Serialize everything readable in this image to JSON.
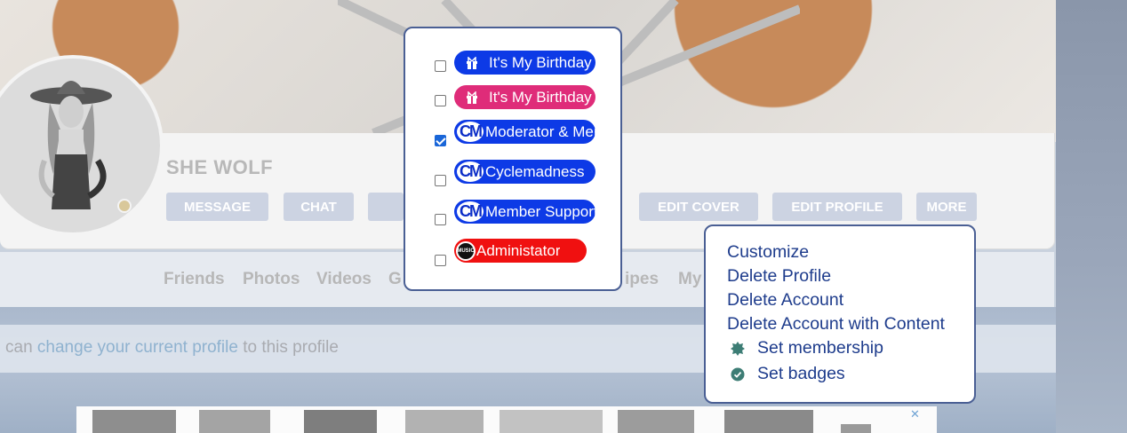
{
  "profile": {
    "name": "SHE WOLF",
    "actions": [
      {
        "label": "MESSAGE"
      },
      {
        "label": "CHAT"
      },
      {
        "label": ""
      },
      {
        "label": "EDIT COVER"
      },
      {
        "label": "EDIT PROFILE"
      },
      {
        "label": "MORE"
      }
    ]
  },
  "nav": {
    "items": [
      "Friends",
      "Photos",
      "Videos",
      "G",
      "ipes",
      "My"
    ]
  },
  "notice": {
    "prefix": "can ",
    "link": "change your current profile",
    "suffix": " to this profile"
  },
  "badges": [
    {
      "label": "It's My Birthday",
      "checked": false,
      "color": "#0d3ae6",
      "icon": "gift-icon"
    },
    {
      "label": "It's My Birthday",
      "checked": false,
      "color": "#df2c79",
      "icon": "gift-icon"
    },
    {
      "label": "Moderator & Member",
      "checked": true,
      "color": "#0d3ae6",
      "icon": "cm-logo-icon",
      "icon_text": "CM"
    },
    {
      "label": "Cyclemadness",
      "checked": false,
      "color": "#0d3ae6",
      "icon": "cm-logo-icon",
      "icon_text": "CM"
    },
    {
      "label": "Member Support",
      "checked": false,
      "color": "#0d3ae6",
      "icon": "cm-logo-icon",
      "icon_text": "CM"
    },
    {
      "label": "Administator",
      "checked": false,
      "color": "#f01010",
      "icon": "music-icon",
      "icon_text": "MUSIC"
    }
  ],
  "more_menu": {
    "items": [
      {
        "label": "Customize",
        "icon": null
      },
      {
        "label": "Delete Profile",
        "icon": null
      },
      {
        "label": "Delete Account",
        "icon": null
      },
      {
        "label": "Delete Account with Content",
        "icon": null
      },
      {
        "label": "Set membership",
        "icon": "membership-badge-icon"
      },
      {
        "label": "Set badges",
        "icon": "check-circle-icon"
      }
    ]
  },
  "ad": {
    "close_label": "✕"
  },
  "colors": {
    "accent": "#1e3c8c",
    "popup_border": "#4a5f94",
    "action_button": "#ccd3e2",
    "icon_green": "#3d7d75"
  }
}
